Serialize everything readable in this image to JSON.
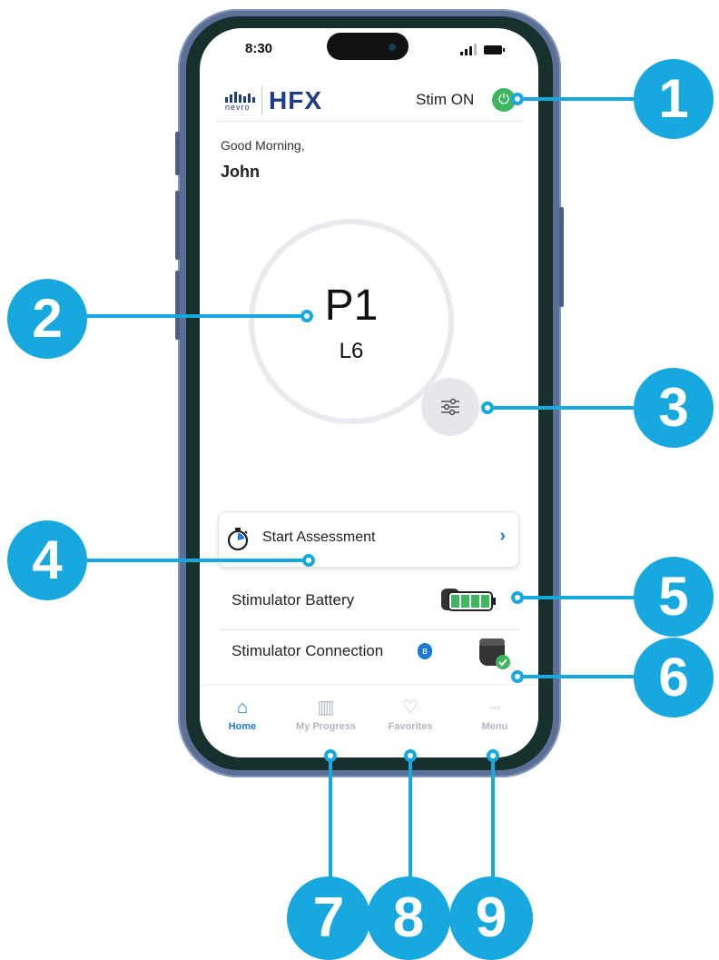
{
  "status_bar": {
    "time": "8:30"
  },
  "header": {
    "logo_word": "nevro",
    "app_name": "HFX",
    "stim_label": "Stim ON",
    "stim_icon": "power-icon"
  },
  "greeting": {
    "line1": "Good Morning,",
    "name": "John"
  },
  "program": {
    "program": "P1",
    "level": "L6",
    "adjust_icon": "sliders-icon"
  },
  "assessment": {
    "label": "Start Assessment",
    "icon": "stopwatch-icon",
    "chevron": "›"
  },
  "battery": {
    "label": "Stimulator Battery",
    "charge_fraction": 1.0,
    "icon": "battery-icon"
  },
  "connection": {
    "label": "Stimulator Connection",
    "bluetooth_glyph": "ʙ",
    "status": "connected"
  },
  "tabs": [
    {
      "label": "Home",
      "icon": "home-icon",
      "glyph": "⌂"
    },
    {
      "label": "My Progress",
      "icon": "bar-chart-icon",
      "glyph": "▥"
    },
    {
      "label": "Favorites",
      "icon": "heart-icon",
      "glyph": "♡"
    },
    {
      "label": "Menu",
      "icon": "more-icon",
      "glyph": "◦◦◦"
    }
  ],
  "callouts": [
    "1",
    "2",
    "3",
    "4",
    "5",
    "6",
    "7",
    "8",
    "9"
  ],
  "colors": {
    "accent": "#18a8e0",
    "brand": "#1d3c8a",
    "stim_on": "#3eb55f",
    "tab_active": "#1f7bd0",
    "battery_fill": "#3eb55f"
  }
}
